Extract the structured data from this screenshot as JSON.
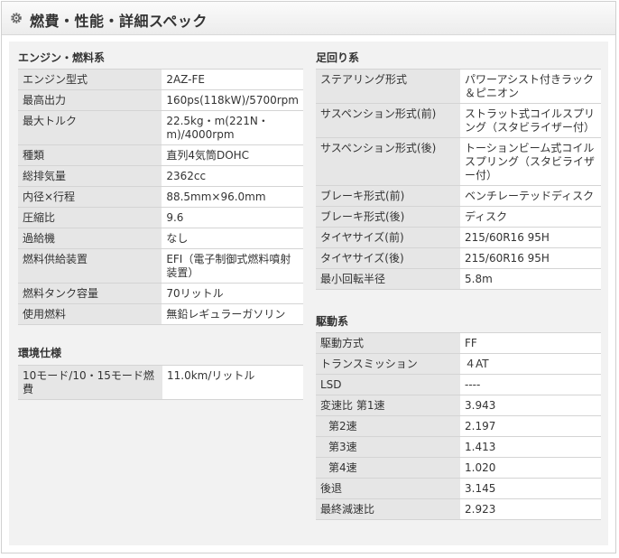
{
  "header": {
    "title": "燃費・性能・詳細スペック"
  },
  "engine": {
    "title": "エンジン・燃料系",
    "rows": [
      {
        "k": "エンジン型式",
        "v": "2AZ-FE"
      },
      {
        "k": "最高出力",
        "v": "160ps(118kW)/5700rpm"
      },
      {
        "k": "最大トルク",
        "v": "22.5kg・m(221N・m)/4000rpm"
      },
      {
        "k": "種類",
        "v": "直列4気筒DOHC"
      },
      {
        "k": "総排気量",
        "v": "2362cc"
      },
      {
        "k": "内径×行程",
        "v": "88.5mm×96.0mm"
      },
      {
        "k": "圧縮比",
        "v": "9.6"
      },
      {
        "k": "過給機",
        "v": "なし"
      },
      {
        "k": "燃料供給装置",
        "v": "EFI（電子制御式燃料噴射装置）"
      },
      {
        "k": "燃料タンク容量",
        "v": "70リットル"
      },
      {
        "k": "使用燃料",
        "v": "無鉛レギュラーガソリン"
      }
    ]
  },
  "environment": {
    "title": "環境仕様",
    "rows": [
      {
        "k": "10モード/10・15モード燃費",
        "v": "11.0km/リットル"
      }
    ]
  },
  "suspension": {
    "title": "足回り系",
    "rows": [
      {
        "k": "ステアリング形式",
        "v": "パワーアシスト付きラック＆ピニオン"
      },
      {
        "k": "サスペンション形式(前)",
        "v": "ストラット式コイルスプリング（スタビライザー付）"
      },
      {
        "k": "サスペンション形式(後)",
        "v": "トーションビーム式コイルスプリング（スタビライザー付）"
      },
      {
        "k": "ブレーキ形式(前)",
        "v": "ベンチレーテッドディスク"
      },
      {
        "k": "ブレーキ形式(後)",
        "v": "ディスク"
      },
      {
        "k": "タイヤサイズ(前)",
        "v": "215/60R16 95H"
      },
      {
        "k": "タイヤサイズ(後)",
        "v": "215/60R16 95H"
      },
      {
        "k": "最小回転半径",
        "v": "5.8m"
      }
    ]
  },
  "drive": {
    "title": "駆動系",
    "rows": [
      {
        "k": "駆動方式",
        "v": "FF"
      },
      {
        "k": "トランスミッション",
        "v": "４AT"
      },
      {
        "k": "LSD",
        "v": "----"
      },
      {
        "k": "変速比 第1速",
        "v": "3.943"
      },
      {
        "k": "第2速",
        "v": "2.197"
      },
      {
        "k": "第3速",
        "v": "1.413"
      },
      {
        "k": "第4速",
        "v": "1.020"
      },
      {
        "k": "後退",
        "v": "3.145"
      },
      {
        "k": "最終減速比",
        "v": "2.923"
      }
    ]
  }
}
